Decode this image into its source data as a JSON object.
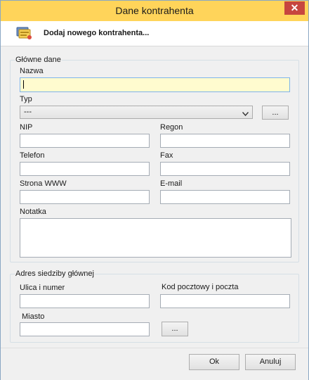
{
  "window": {
    "title": "Dane kontrahenta",
    "close_glyph": "✕"
  },
  "header": {
    "text": "Dodaj nowego kontrahenta...",
    "icon": "contacts-icon"
  },
  "main_group": {
    "legend": "Główne dane",
    "nazwa_label": "Nazwa",
    "nazwa_value": "",
    "typ_label": "Typ",
    "typ_value": "---",
    "typ_more_button": "...",
    "nip_label": "NIP",
    "regon_label": "Regon",
    "telefon_label": "Telefon",
    "fax_label": "Fax",
    "www_label": "Strona WWW",
    "email_label": "E-mail",
    "notatka_label": "Notatka"
  },
  "address_group": {
    "legend": "Adres siedziby głównej",
    "street_label": "Ulica i numer",
    "postal_label": "Kod pocztowy i poczta",
    "city_label": "Miasto",
    "city_more_button": "..."
  },
  "footer": {
    "ok_label": "Ok",
    "cancel_label": "Anuluj"
  },
  "colors": {
    "titlebar": "#ffd45a",
    "close_button": "#c7463f",
    "focused_field": "#fffbcf"
  }
}
